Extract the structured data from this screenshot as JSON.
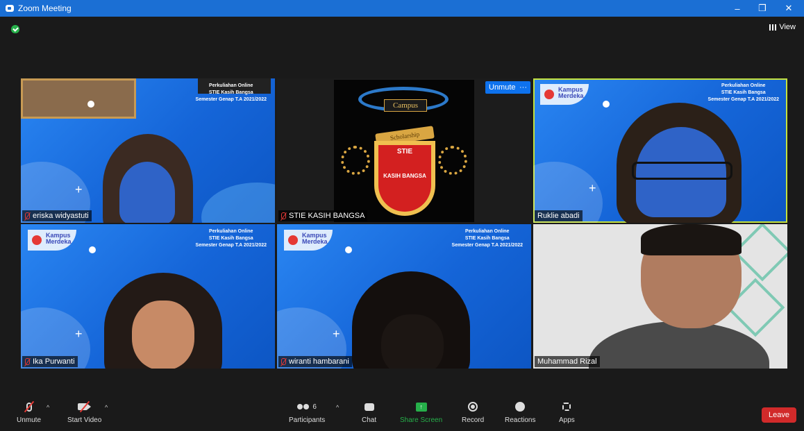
{
  "window": {
    "title": "Zoom Meeting",
    "controls": [
      "–",
      "❐",
      "✕"
    ]
  },
  "header": {
    "view_label": "View"
  },
  "banner": {
    "line1": "Perkuliahan Online",
    "line2": "STIE Kasih Bangsa",
    "line3": "Semester Genap T.A 2021/2022",
    "logo_text1": "Kampus",
    "logo_text2": "Merdeka"
  },
  "crest": {
    "top": "Campus",
    "ribbon": "Scholarship",
    "center": "STIE",
    "shield": "KASIH BANGSA"
  },
  "tile_actions": {
    "unmute": "Unmute",
    "more": "···"
  },
  "participants_tiles": [
    {
      "name": "eriska widyastuti",
      "muted": true
    },
    {
      "name": "STIE KASIH BANGSA",
      "muted": true
    },
    {
      "name": "Ruklie abadi",
      "muted": false,
      "active_speaker": true
    },
    {
      "name": "Ika Purwanti",
      "muted": true
    },
    {
      "name": "wiranti hambarani",
      "muted": true
    },
    {
      "name": "Muhammad Rizal",
      "muted": false
    }
  ],
  "toolbar": {
    "unmute": "Unmute",
    "start_video": "Start Video",
    "participants": "Participants",
    "participants_count": "6",
    "chat": "Chat",
    "share_screen": "Share Screen",
    "record": "Record",
    "reactions": "Reactions",
    "apps": "Apps",
    "leave": "Leave"
  },
  "colors": {
    "accent": "#0e72ed",
    "share": "#26b04a",
    "leave": "#d12a2a",
    "active_border": "#c5e23d"
  }
}
